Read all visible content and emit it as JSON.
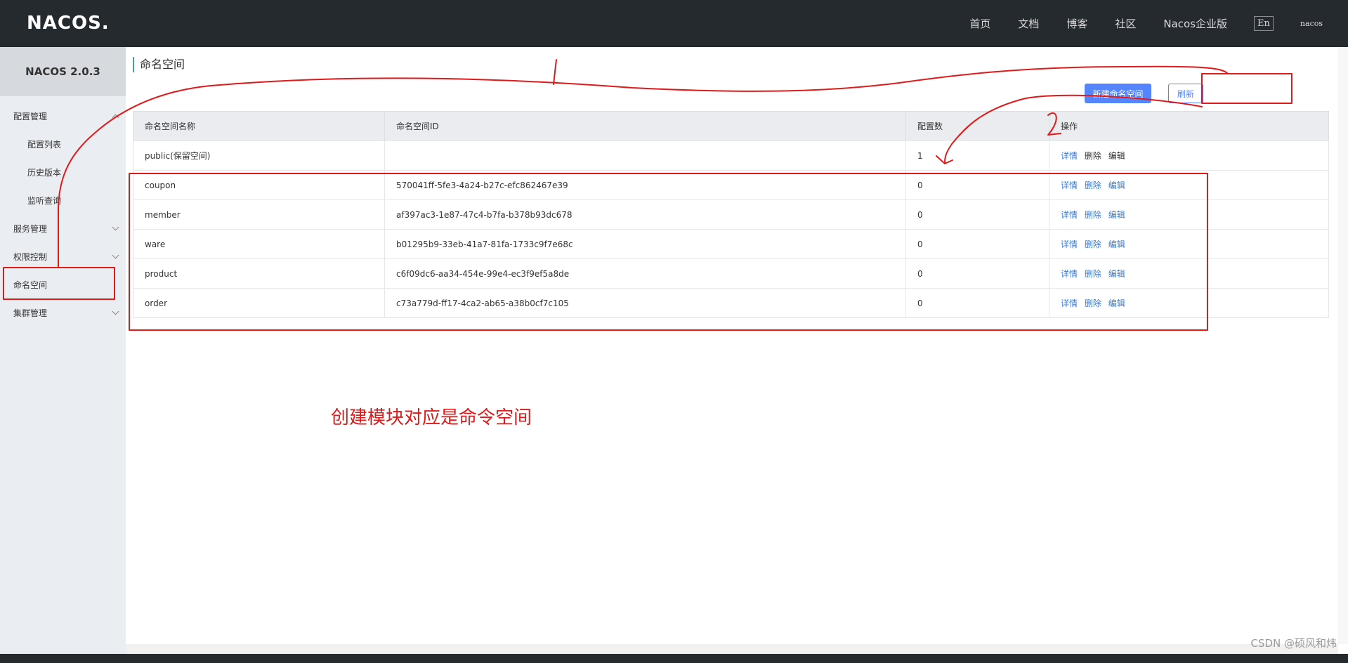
{
  "header": {
    "logo": "NACOS.",
    "nav": [
      "首页",
      "文档",
      "博客",
      "社区",
      "Nacos企业版"
    ],
    "lang": "En",
    "user": "nacos"
  },
  "sidebar": {
    "title": "NACOS 2.0.3",
    "items": [
      {
        "label": "配置管理",
        "chevron": "up"
      },
      {
        "label": "配置列表",
        "sub": true
      },
      {
        "label": "历史版本",
        "sub": true
      },
      {
        "label": "监听查询",
        "sub": true
      },
      {
        "label": "服务管理",
        "chevron": "down"
      },
      {
        "label": "权限控制",
        "chevron": "down"
      },
      {
        "label": "命名空间",
        "active": true
      },
      {
        "label": "集群管理",
        "chevron": "down"
      }
    ]
  },
  "main": {
    "title": "命名空间",
    "create_button": "新建命名空间",
    "refresh_button": "刷新",
    "table": {
      "headers": [
        "命名空间名称",
        "命名空间ID",
        "配置数",
        "操作"
      ],
      "rows": [
        {
          "name": "public(保留空间)",
          "id": "",
          "count": "1"
        },
        {
          "name": "coupon",
          "id": "570041ff-5fe3-4a24-b27c-efc862467e39",
          "count": "0"
        },
        {
          "name": "member",
          "id": "af397ac3-1e87-47c4-b7fa-b378b93dc678",
          "count": "0"
        },
        {
          "name": "ware",
          "id": "b01295b9-33eb-41a7-81fa-1733c9f7e68c",
          "count": "0"
        },
        {
          "name": "product",
          "id": "c6f09dc6-aa34-454e-99e4-ec3f9ef5a8de",
          "count": "0"
        },
        {
          "name": "order",
          "id": "c73a779d-ff17-4ca2-ab65-a38b0cf7c105",
          "count": "0"
        }
      ],
      "actions": [
        "详情",
        "删除",
        "编辑"
      ]
    }
  },
  "annotation": {
    "text": "创建模块对应是命令空间",
    "color": "#e01919",
    "number": "2"
  },
  "watermark": "CSDN @硕风和炜"
}
